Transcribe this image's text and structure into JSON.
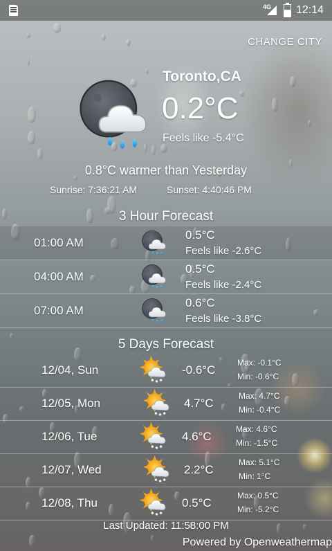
{
  "status_bar": {
    "network_type": "4G",
    "time": "12:14",
    "battery_level": 0.6
  },
  "header": {
    "change_city_label": "CHANGE CITY",
    "city": "Toronto,CA",
    "temperature": "0.2°C",
    "feels_like": "Feels like -5.4°C",
    "comparison": "0.8°C warmer than Yesterday",
    "sunrise": "Sunrise: 7:36:21 AM",
    "sunset": "Sunset: 4:40:46 PM",
    "icon": "night-cloud-rain-icon"
  },
  "hourly": {
    "title": "3 Hour Forecast",
    "items": [
      {
        "time": "01:00 AM",
        "temp": "0.5°C",
        "feels": "Feels like -2.6°C",
        "icon": "night-cloud-rain-icon"
      },
      {
        "time": "04:00 AM",
        "temp": "0.5°C",
        "feels": "Feels like -2.4°C",
        "icon": "night-cloud-rain-icon"
      },
      {
        "time": "07:00 AM",
        "temp": "0.6°C",
        "feels": "Feels like -3.8°C",
        "icon": "night-cloud-rain-icon"
      }
    ]
  },
  "daily": {
    "title": "5 Days Forecast",
    "items": [
      {
        "date": "12/04, Sun",
        "temp": "-0.6°C",
        "max": "Max: -0.1°C",
        "min": "Min: -0.6°C",
        "icon": "sun-cloud-snow-icon"
      },
      {
        "date": "12/05, Mon",
        "temp": "4.7°C",
        "max": "Max: 4.7°C",
        "min": "Min: -0.4°C",
        "icon": "sun-cloud-snow-icon"
      },
      {
        "date": "12/06, Tue",
        "temp": "4.6°C",
        "max": "Max: 4.6°C",
        "min": "Min: -1.5°C",
        "icon": "sun-cloud-snow-icon"
      },
      {
        "date": "12/07, Wed",
        "temp": "2.2°C",
        "max": "Max: 5.1°C",
        "min": "Min: 1°C",
        "icon": "sun-cloud-snow-icon"
      },
      {
        "date": "12/08, Thu",
        "temp": "0.5°C",
        "max": "Max: 0.5°C",
        "min": "Min: -5.2°C",
        "icon": "sun-cloud-snow-icon"
      }
    ]
  },
  "footer": {
    "last_updated": "Last Updated: 11:58:00 PM",
    "powered_by": "Powered by Openweathermap"
  }
}
